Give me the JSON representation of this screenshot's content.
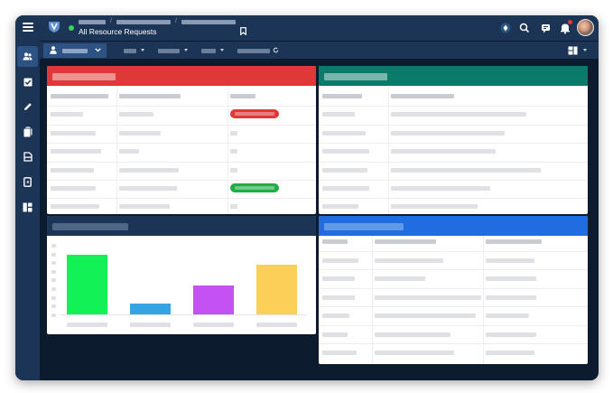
{
  "header": {
    "title": "All Resource Requests",
    "icons": [
      "menu-icon",
      "logo-icon",
      "bookmark-icon",
      "help-icon",
      "search-icon",
      "chat-icon",
      "bell-icon",
      "avatar"
    ]
  },
  "sidebar": {
    "items": [
      {
        "icon": "users-icon",
        "active": true
      },
      {
        "icon": "checkbox-icon",
        "active": false
      },
      {
        "icon": "pencil-icon",
        "active": false
      },
      {
        "icon": "documents-icon",
        "active": false
      },
      {
        "icon": "report-icon",
        "active": false
      },
      {
        "icon": "exit-icon",
        "active": false
      },
      {
        "icon": "dashboard-icon",
        "active": false
      }
    ]
  },
  "colors": {
    "red_panel": "#df3838",
    "teal_panel": "#0a7b6a",
    "navy_panel": "#1c3556",
    "blue_panel": "#1f6de0",
    "status_red": "#df3838",
    "status_green": "#1fad45"
  },
  "chart_data": {
    "type": "bar",
    "categories": [
      "",
      "",
      "",
      ""
    ],
    "values": [
      82,
      15,
      40,
      68
    ],
    "colors": [
      "#12f255",
      "#36a4e2",
      "#c452f3",
      "#fccf57"
    ],
    "ylim": [
      0,
      100
    ],
    "title": "",
    "xlabel": "",
    "ylabel": ""
  },
  "red_table": {
    "status_pills": [
      {
        "row": 1,
        "color": "red"
      },
      {
        "row": 5,
        "color": "green"
      }
    ]
  }
}
